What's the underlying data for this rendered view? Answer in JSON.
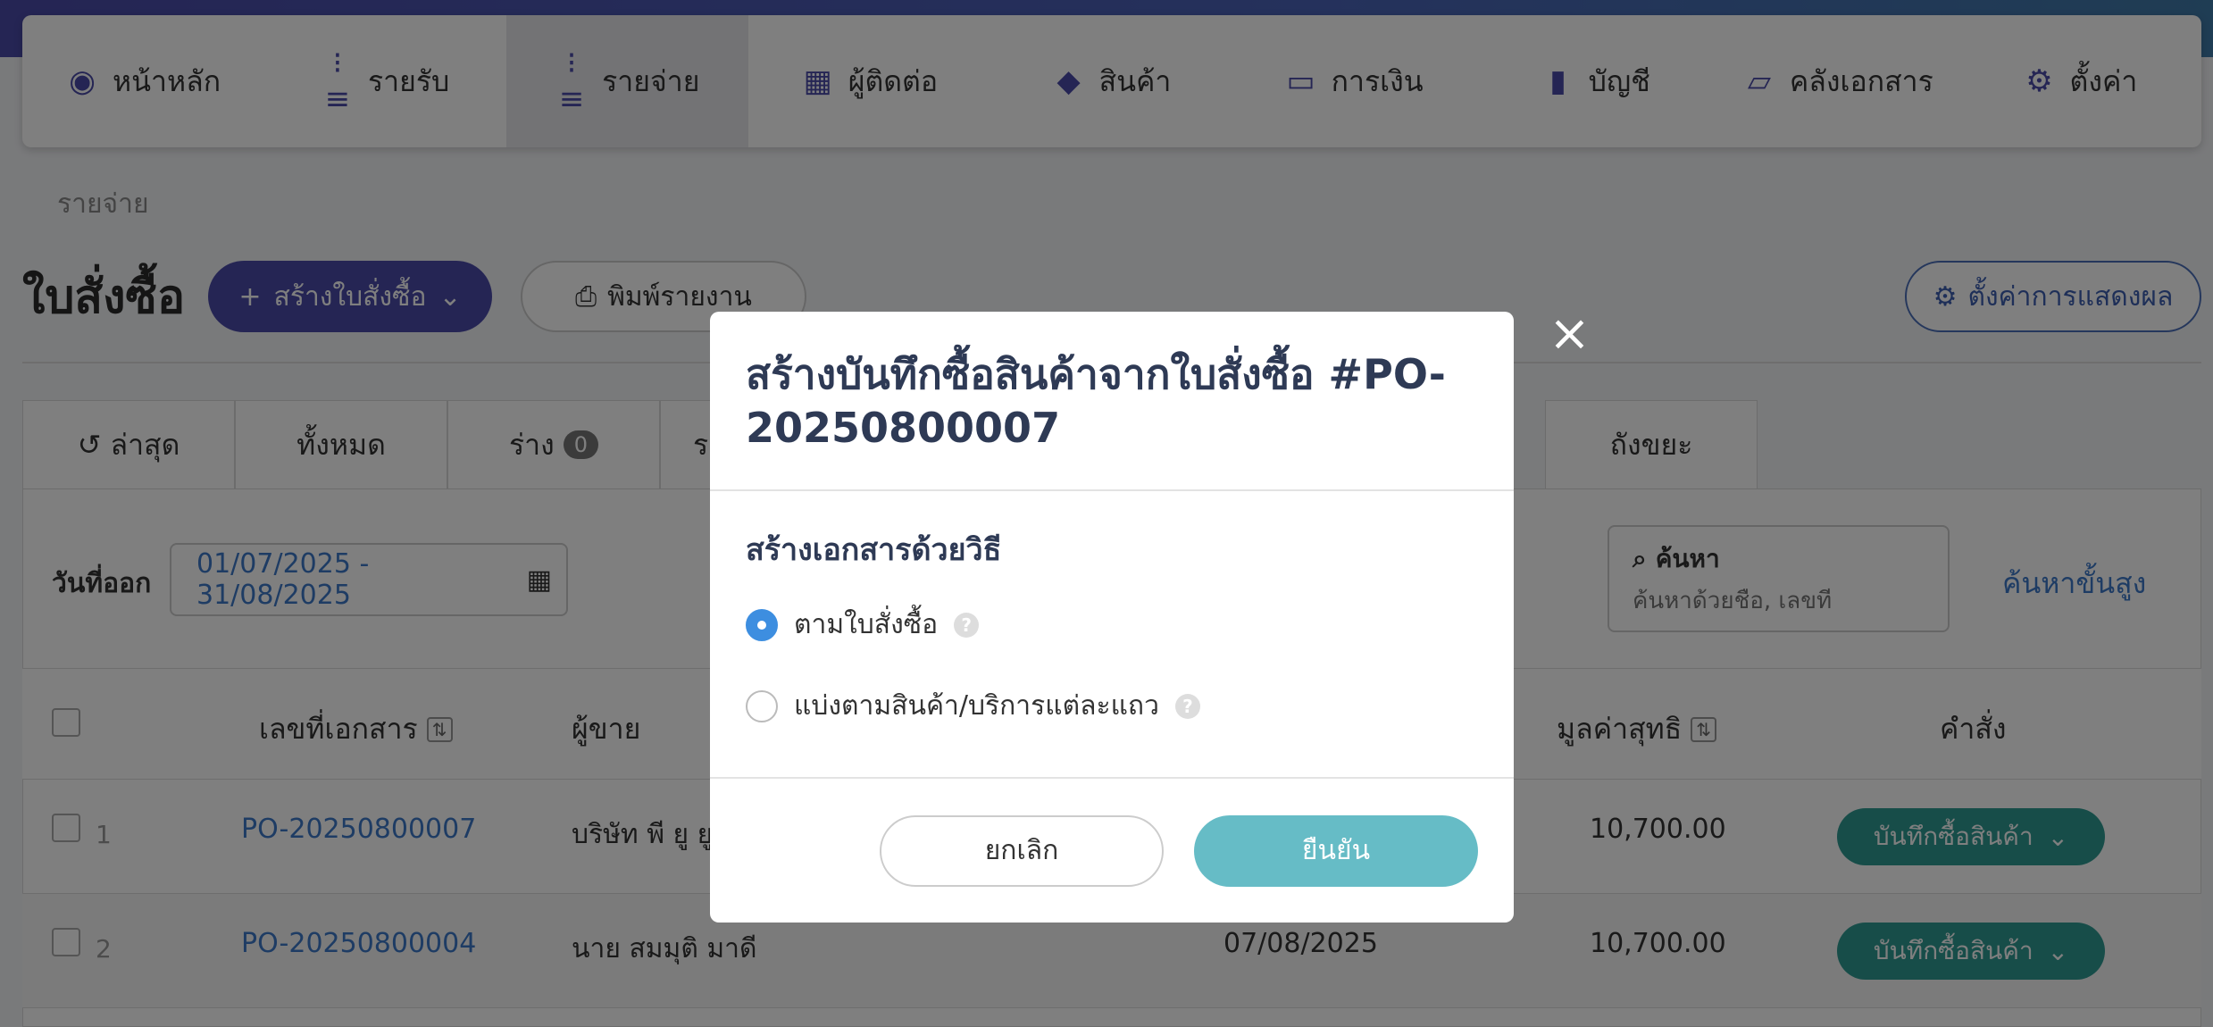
{
  "nav": {
    "items": [
      {
        "label": "หน้าหลัก",
        "icon": "dashboard-icon",
        "glyph": "◉",
        "active": false
      },
      {
        "label": "รายรับ",
        "icon": "list-down-icon",
        "glyph": "⁝≡",
        "active": false
      },
      {
        "label": "รายจ่าย",
        "icon": "list-up-icon",
        "glyph": "⁝≡",
        "active": true
      },
      {
        "label": "ผู้ติดต่อ",
        "icon": "building-user-icon",
        "glyph": "▦",
        "active": false
      },
      {
        "label": "สินค้า",
        "icon": "box-icon",
        "glyph": "◆",
        "active": false
      },
      {
        "label": "การเงิน",
        "icon": "money-icon",
        "glyph": "▭",
        "active": false
      },
      {
        "label": "บัญชี",
        "icon": "book-icon",
        "glyph": "▮",
        "active": false
      },
      {
        "label": "คลังเอกสาร",
        "icon": "folder-icon",
        "glyph": "▱",
        "active": false
      },
      {
        "label": "ตั้งค่า",
        "icon": "gear-icon",
        "glyph": "⚙",
        "active": false
      }
    ]
  },
  "breadcrumb": "รายจ่าย",
  "page": {
    "title": "ใบสั่งซื้อ",
    "create_label": "สร้างใบสั่งซื้อ",
    "print_label": "พิมพ์รายงาน",
    "display_settings_label": "ตั้งค่าการแสดงผล"
  },
  "tabs": {
    "latest": "ล่าสุด",
    "all": "ทั้งหมด",
    "draft": "ร่าง",
    "draft_count": "0",
    "partial": "ร",
    "trash": "ถังขยะ"
  },
  "filter": {
    "date_label": "วันที่ออก",
    "date_range": "01/07/2025 - 31/08/2025",
    "search_label": "ค้นหา",
    "search_placeholder": "ค้นหาด้วยชื่อ, เลขที่",
    "advanced_label": "ค้นหาขั้นสูง"
  },
  "table": {
    "headers": {
      "doc_no": "เลขที่เอกสาร",
      "vendor": "ผู้ขาย",
      "net": "มูลค่าสุทธิ",
      "action": "คำสั่ง"
    },
    "rows": [
      {
        "num": "1",
        "doc_no": "PO-20250800007",
        "vendor": "บริษัท พี ยู ยู",
        "date": "",
        "net": "10,700.00",
        "action": "บันทึกซื้อสินค้า"
      },
      {
        "num": "2",
        "doc_no": "PO-20250800004",
        "vendor": "นาย สมมุติ มาดี",
        "date": "07/08/2025",
        "net": "10,700.00",
        "action": "บันทึกซื้อสินค้า"
      }
    ]
  },
  "modal": {
    "title": "สร้างบันทึกซื้อสินค้าจากใบสั่งซื้อ #PO-20250800007",
    "section_title": "สร้างเอกสารด้วยวิธี",
    "options": [
      {
        "label": "ตามใบสั่งซื้อ",
        "selected": true
      },
      {
        "label": "แบ่งตามสินค้า/บริการแต่ละแถว",
        "selected": false
      }
    ],
    "cancel_label": "ยกเลิก",
    "confirm_label": "ยืนยัน"
  },
  "colors": {
    "brand": "#4a4aa8",
    "link": "#3d78c8",
    "teal": "#2f9a92",
    "confirm": "#66bcc6"
  }
}
